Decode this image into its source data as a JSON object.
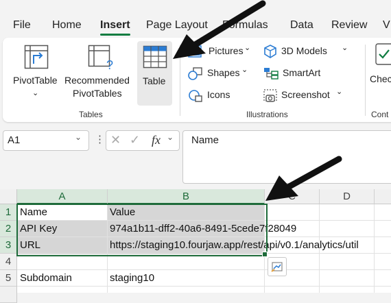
{
  "menu": {
    "tabs": [
      {
        "label": "File"
      },
      {
        "label": "Home"
      },
      {
        "label": "Insert"
      },
      {
        "label": "Page Layout"
      },
      {
        "label": "Formulas"
      },
      {
        "label": "Data"
      },
      {
        "label": "Review"
      },
      {
        "label": "V"
      }
    ]
  },
  "ribbon": {
    "tables": {
      "pivottable": "PivotTable",
      "recommended_line1": "Recommended",
      "recommended_line2": "PivotTables",
      "table": "Table",
      "group_label": "Tables"
    },
    "illustrations": {
      "pictures": "Pictures",
      "shapes": "Shapes",
      "icons": "Icons",
      "models": "3D Models",
      "smartart": "SmartArt",
      "screenshot": "Screenshot",
      "group_label": "Illustrations"
    },
    "next": {
      "partial_label": "Check",
      "partial_group": "Cont"
    }
  },
  "formula_bar": {
    "name_box": "A1",
    "fx": "fx",
    "content": "Name"
  },
  "grid": {
    "columns": [
      "A",
      "B",
      "C",
      "D"
    ],
    "rows": [
      "1",
      "2",
      "3",
      "4",
      "5"
    ],
    "cells": {
      "A1": "Name",
      "B1": "Value",
      "A2": "API Key",
      "B2": "974a1b11-dff2-40a6-8491-5cede7f28049",
      "A3": "URL",
      "B3": "https://staging10.fourjaw.app/rest/api/v0.1/analytics/util",
      "A5": "Subdomain",
      "B5": "staging10"
    }
  },
  "colors": {
    "accent": "#107c41",
    "selection_border": "#1e6b3a",
    "selection_fill": "#d6d6d6"
  }
}
